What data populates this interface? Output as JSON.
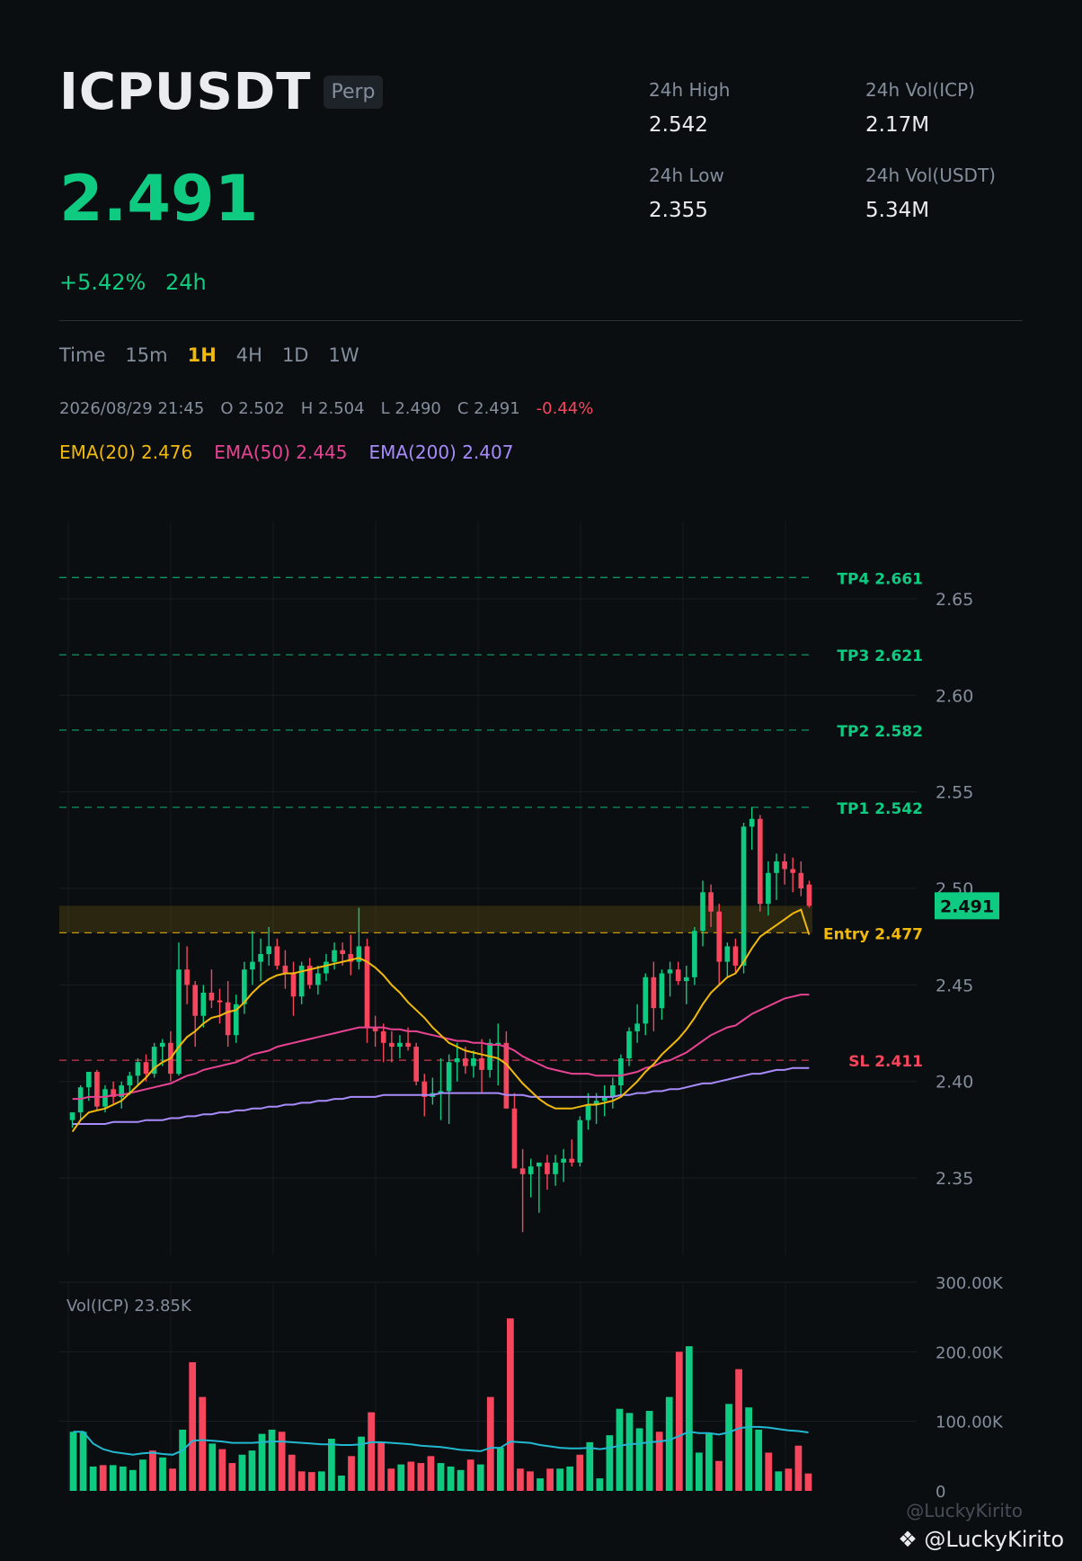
{
  "header": {
    "symbol": "ICPUSDT",
    "badge": "Perp",
    "price": "2.491",
    "change_pct": "+5.42%",
    "change_period": "24h",
    "stats": [
      {
        "label": "24h High",
        "value": "2.542"
      },
      {
        "label": "24h Vol(ICP)",
        "value": "2.17M"
      },
      {
        "label": "24h Low",
        "value": "2.355"
      },
      {
        "label": "24h Vol(USDT)",
        "value": "5.34M"
      }
    ]
  },
  "timeframes": {
    "items": [
      "Time",
      "15m",
      "1H",
      "4H",
      "1D",
      "1W"
    ],
    "active": "1H"
  },
  "ohlc": {
    "time": "2026/08/29 21:45",
    "open": "O 2.502",
    "high": "H 2.504",
    "low": "L 2.490",
    "close": "C 2.491",
    "change": "-0.44%"
  },
  "emas": [
    {
      "label": "EMA(20) 2.476",
      "color": "#f0b90b"
    },
    {
      "label": "EMA(50) 2.445",
      "color": "#e84393"
    },
    {
      "label": "EMA(200) 2.407",
      "color": "#a78bfa"
    }
  ],
  "colors": {
    "up": "#0ecb81",
    "down": "#f6465d",
    "ema20": "#f0b90b",
    "ema50": "#e84393",
    "ema200": "#a78bfa",
    "vol_ma": "#22b8cf"
  },
  "chart_data": {
    "type": "candlestick",
    "y_ticks": [
      2.35,
      2.4,
      2.45,
      2.5,
      2.55,
      2.6,
      2.65
    ],
    "ylim": [
      2.31,
      2.69
    ],
    "last_price": 2.491,
    "levels": [
      {
        "label": "TP4 2.661",
        "value": 2.661,
        "color": "#0ecb81"
      },
      {
        "label": "TP3 2.621",
        "value": 2.621,
        "color": "#0ecb81"
      },
      {
        "label": "TP2 2.582",
        "value": 2.582,
        "color": "#0ecb81"
      },
      {
        "label": "TP1 2.542",
        "value": 2.542,
        "color": "#0ecb81"
      },
      {
        "label": "Entry 2.477",
        "value": 2.477,
        "color": "#f0b90b"
      },
      {
        "label": "SL 2.411",
        "value": 2.411,
        "color": "#f6465d"
      }
    ],
    "zone": {
      "from": 2.477,
      "to": 2.491
    },
    "candles": [
      [
        2.38,
        2.384,
        2.376,
        2.384
      ],
      [
        2.384,
        2.398,
        2.38,
        2.397
      ],
      [
        2.397,
        2.405,
        2.39,
        2.405
      ],
      [
        2.405,
        2.406,
        2.385,
        2.387
      ],
      [
        2.387,
        2.398,
        2.384,
        2.396
      ],
      [
        2.396,
        2.4,
        2.388,
        2.392
      ],
      [
        2.392,
        2.4,
        2.386,
        2.398
      ],
      [
        2.398,
        2.405,
        2.393,
        2.403
      ],
      [
        2.403,
        2.412,
        2.398,
        2.41
      ],
      [
        2.41,
        2.414,
        2.4,
        2.404
      ],
      [
        2.404,
        2.42,
        2.402,
        2.418
      ],
      [
        2.418,
        2.422,
        2.408,
        2.42
      ],
      [
        2.42,
        2.426,
        2.4,
        2.404
      ],
      [
        2.404,
        2.472,
        2.403,
        2.458
      ],
      [
        2.458,
        2.47,
        2.44,
        2.45
      ],
      [
        2.45,
        2.452,
        2.418,
        2.434
      ],
      [
        2.434,
        2.45,
        2.428,
        2.446
      ],
      [
        2.446,
        2.458,
        2.438,
        2.442
      ],
      [
        2.442,
        2.448,
        2.43,
        2.441
      ],
      [
        2.441,
        2.452,
        2.418,
        2.424
      ],
      [
        2.424,
        2.445,
        2.42,
        2.44
      ],
      [
        2.44,
        2.462,
        2.435,
        2.458
      ],
      [
        2.458,
        2.478,
        2.45,
        2.462
      ],
      [
        2.462,
        2.474,
        2.452,
        2.466
      ],
      [
        2.466,
        2.48,
        2.46,
        2.47
      ],
      [
        2.47,
        2.474,
        2.458,
        2.46
      ],
      [
        2.46,
        2.468,
        2.448,
        2.456
      ],
      [
        2.456,
        2.462,
        2.434,
        2.444
      ],
      [
        2.444,
        2.462,
        2.44,
        2.46
      ],
      [
        2.46,
        2.464,
        2.448,
        2.45
      ],
      [
        2.45,
        2.46,
        2.445,
        2.456
      ],
      [
        2.456,
        2.466,
        2.452,
        2.462
      ],
      [
        2.462,
        2.472,
        2.458,
        2.468
      ],
      [
        2.468,
        2.472,
        2.46,
        2.466
      ],
      [
        2.466,
        2.476,
        2.455,
        2.462
      ],
      [
        2.462,
        2.49,
        2.458,
        2.47
      ],
      [
        2.47,
        2.474,
        2.42,
        2.428
      ],
      [
        2.428,
        2.434,
        2.418,
        2.426
      ],
      [
        2.426,
        2.43,
        2.41,
        2.42
      ],
      [
        2.42,
        2.426,
        2.41,
        2.418
      ],
      [
        2.418,
        2.424,
        2.412,
        2.42
      ],
      [
        2.42,
        2.428,
        2.416,
        2.418
      ],
      [
        2.418,
        2.42,
        2.398,
        2.4
      ],
      [
        2.4,
        2.404,
        2.382,
        2.392
      ],
      [
        2.392,
        2.402,
        2.388,
        2.394
      ],
      [
        2.394,
        2.412,
        2.38,
        2.395
      ],
      [
        2.395,
        2.414,
        2.378,
        2.41
      ],
      [
        2.41,
        2.42,
        2.4,
        2.412
      ],
      [
        2.412,
        2.418,
        2.404,
        2.408
      ],
      [
        2.408,
        2.416,
        2.402,
        2.412
      ],
      [
        2.412,
        2.422,
        2.394,
        2.406
      ],
      [
        2.406,
        2.422,
        2.402,
        2.42
      ],
      [
        2.42,
        2.43,
        2.398,
        2.42
      ],
      [
        2.42,
        2.426,
        2.386,
        2.386
      ],
      [
        2.386,
        2.394,
        2.355,
        2.355
      ],
      [
        2.355,
        2.365,
        2.322,
        2.352
      ],
      [
        2.352,
        2.36,
        2.34,
        2.356
      ],
      [
        2.356,
        2.358,
        2.332,
        2.358
      ],
      [
        2.358,
        2.362,
        2.344,
        2.352
      ],
      [
        2.352,
        2.362,
        2.346,
        2.358
      ],
      [
        2.358,
        2.365,
        2.348,
        2.36
      ],
      [
        2.36,
        2.37,
        2.356,
        2.358
      ],
      [
        2.358,
        2.382,
        2.356,
        2.38
      ],
      [
        2.38,
        2.394,
        2.375,
        2.388
      ],
      [
        2.388,
        2.394,
        2.378,
        2.39
      ],
      [
        2.39,
        2.398,
        2.382,
        2.392
      ],
      [
        2.392,
        2.402,
        2.386,
        2.398
      ],
      [
        2.398,
        2.414,
        2.392,
        2.412
      ],
      [
        2.412,
        2.428,
        2.408,
        2.426
      ],
      [
        2.426,
        2.44,
        2.42,
        2.43
      ],
      [
        2.43,
        2.456,
        2.424,
        2.454
      ],
      [
        2.454,
        2.462,
        2.426,
        2.438
      ],
      [
        2.438,
        2.458,
        2.432,
        2.456
      ],
      [
        2.456,
        2.462,
        2.444,
        2.458
      ],
      [
        2.458,
        2.462,
        2.45,
        2.452
      ],
      [
        2.452,
        2.46,
        2.44,
        2.454
      ],
      [
        2.454,
        2.48,
        2.45,
        2.478
      ],
      [
        2.478,
        2.504,
        2.47,
        2.498
      ],
      [
        2.498,
        2.502,
        2.48,
        2.488
      ],
      [
        2.488,
        2.492,
        2.45,
        2.462
      ],
      [
        2.462,
        2.472,
        2.454,
        2.47
      ],
      [
        2.47,
        2.474,
        2.456,
        2.46
      ],
      [
        2.46,
        2.534,
        2.456,
        2.532
      ],
      [
        2.532,
        2.542,
        2.52,
        2.536
      ],
      [
        2.536,
        2.538,
        2.488,
        2.492
      ],
      [
        2.492,
        2.514,
        2.486,
        2.508
      ],
      [
        2.508,
        2.518,
        2.494,
        2.514
      ],
      [
        2.514,
        2.518,
        2.502,
        2.51
      ],
      [
        2.51,
        2.516,
        2.498,
        2.508
      ],
      [
        2.508,
        2.514,
        2.496,
        2.5
      ],
      [
        2.502,
        2.504,
        2.49,
        2.491
      ]
    ],
    "ema20": [
      2.374,
      2.38,
      2.384,
      2.385,
      2.386,
      2.388,
      2.39,
      2.394,
      2.398,
      2.402,
      2.407,
      2.41,
      2.412,
      2.418,
      2.423,
      2.426,
      2.43,
      2.433,
      2.434,
      2.436,
      2.437,
      2.441,
      2.446,
      2.45,
      2.453,
      2.455,
      2.456,
      2.456,
      2.457,
      2.458,
      2.459,
      2.46,
      2.461,
      2.462,
      2.463,
      2.464,
      2.462,
      2.459,
      2.455,
      2.45,
      2.446,
      2.441,
      2.437,
      2.433,
      2.428,
      2.424,
      2.42,
      2.418,
      2.416,
      2.415,
      2.414,
      2.413,
      2.412,
      2.409,
      2.404,
      2.399,
      2.395,
      2.391,
      2.388,
      2.386,
      2.386,
      2.386,
      2.387,
      2.388,
      2.388,
      2.389,
      2.39,
      2.392,
      2.396,
      2.4,
      2.405,
      2.409,
      2.414,
      2.418,
      2.422,
      2.427,
      2.433,
      2.44,
      2.446,
      2.45,
      2.454,
      2.456,
      2.462,
      2.469,
      2.475,
      2.478,
      2.481,
      2.484,
      2.487,
      2.489,
      2.476
    ],
    "ema50": [
      2.391,
      2.391,
      2.392,
      2.392,
      2.392,
      2.393,
      2.393,
      2.394,
      2.395,
      2.396,
      2.397,
      2.398,
      2.399,
      2.401,
      2.403,
      2.404,
      2.406,
      2.407,
      2.408,
      2.409,
      2.41,
      2.412,
      2.414,
      2.415,
      2.416,
      2.418,
      2.419,
      2.42,
      2.421,
      2.422,
      2.423,
      2.424,
      2.425,
      2.426,
      2.427,
      2.428,
      2.428,
      2.428,
      2.428,
      2.427,
      2.427,
      2.426,
      2.426,
      2.425,
      2.424,
      2.423,
      2.422,
      2.421,
      2.421,
      2.42,
      2.42,
      2.419,
      2.419,
      2.418,
      2.416,
      2.413,
      2.411,
      2.409,
      2.407,
      2.406,
      2.405,
      2.404,
      2.404,
      2.404,
      2.403,
      2.403,
      2.403,
      2.403,
      2.404,
      2.405,
      2.407,
      2.408,
      2.41,
      2.411,
      2.413,
      2.415,
      2.418,
      2.421,
      2.424,
      2.426,
      2.428,
      2.429,
      2.432,
      2.435,
      2.437,
      2.439,
      2.441,
      2.443,
      2.444,
      2.445,
      2.445
    ],
    "ema200": [
      2.378,
      2.378,
      2.378,
      2.378,
      2.378,
      2.379,
      2.379,
      2.379,
      2.379,
      2.38,
      2.38,
      2.38,
      2.381,
      2.381,
      2.382,
      2.382,
      2.383,
      2.383,
      2.384,
      2.384,
      2.385,
      2.385,
      2.386,
      2.386,
      2.387,
      2.387,
      2.388,
      2.388,
      2.389,
      2.389,
      2.39,
      2.39,
      2.391,
      2.391,
      2.392,
      2.392,
      2.392,
      2.392,
      2.393,
      2.393,
      2.393,
      2.393,
      2.393,
      2.393,
      2.393,
      2.394,
      2.394,
      2.394,
      2.394,
      2.394,
      2.394,
      2.394,
      2.394,
      2.393,
      2.393,
      2.393,
      2.392,
      2.392,
      2.392,
      2.392,
      2.392,
      2.392,
      2.392,
      2.392,
      2.392,
      2.392,
      2.392,
      2.393,
      2.393,
      2.394,
      2.394,
      2.395,
      2.395,
      2.396,
      2.396,
      2.397,
      2.398,
      2.399,
      2.399,
      2.4,
      2.401,
      2.402,
      2.403,
      2.404,
      2.404,
      2.405,
      2.406,
      2.406,
      2.407,
      2.407,
      2.407
    ],
    "volume": {
      "label": "Vol(ICP) 23.85K",
      "y_ticks": [
        0,
        100000,
        200000,
        300000
      ],
      "y_tick_labels": [
        "0",
        "100.00K",
        "200.00K",
        "300.00K"
      ],
      "ylim": [
        0,
        300000
      ],
      "values": [
        85000,
        85000,
        35000,
        37000,
        37000,
        35000,
        30000,
        45000,
        58000,
        48000,
        32000,
        88000,
        185000,
        135000,
        68000,
        60000,
        40000,
        52000,
        58000,
        82000,
        88000,
        85000,
        52000,
        28000,
        27000,
        28000,
        75000,
        22000,
        50000,
        78000,
        113000,
        70000,
        32000,
        38000,
        42000,
        40000,
        50000,
        40000,
        35000,
        30000,
        45000,
        38000,
        135000,
        62000,
        248000,
        32000,
        28000,
        18000,
        32000,
        32000,
        35000,
        52000,
        70000,
        18000,
        80000,
        118000,
        112000,
        90000,
        115000,
        85000,
        135000,
        200000,
        208000,
        55000,
        82000,
        43000,
        125000,
        175000,
        120000,
        88000,
        55000,
        28000,
        32000,
        65000,
        25000
      ],
      "ma": [
        85000,
        85000,
        68000,
        60000,
        56000,
        54000,
        52000,
        54000,
        55000,
        53000,
        52000,
        58000,
        72000,
        73000,
        72000,
        71000,
        69000,
        69000,
        69000,
        70000,
        71000,
        71000,
        70000,
        69000,
        68000,
        67000,
        67000,
        66000,
        66000,
        67000,
        70000,
        70000,
        69000,
        68000,
        67000,
        65000,
        64000,
        63000,
        61000,
        59000,
        58000,
        57000,
        62000,
        62000,
        71000,
        70000,
        69000,
        66000,
        64000,
        62000,
        61000,
        61000,
        62000,
        60000,
        62000,
        65000,
        67000,
        68000,
        70000,
        71000,
        73000,
        79000,
        85000,
        83000,
        83000,
        81000,
        84000,
        90000,
        92000,
        92000,
        91000,
        89000,
        87000,
        86000,
        84000
      ]
    }
  }
}
